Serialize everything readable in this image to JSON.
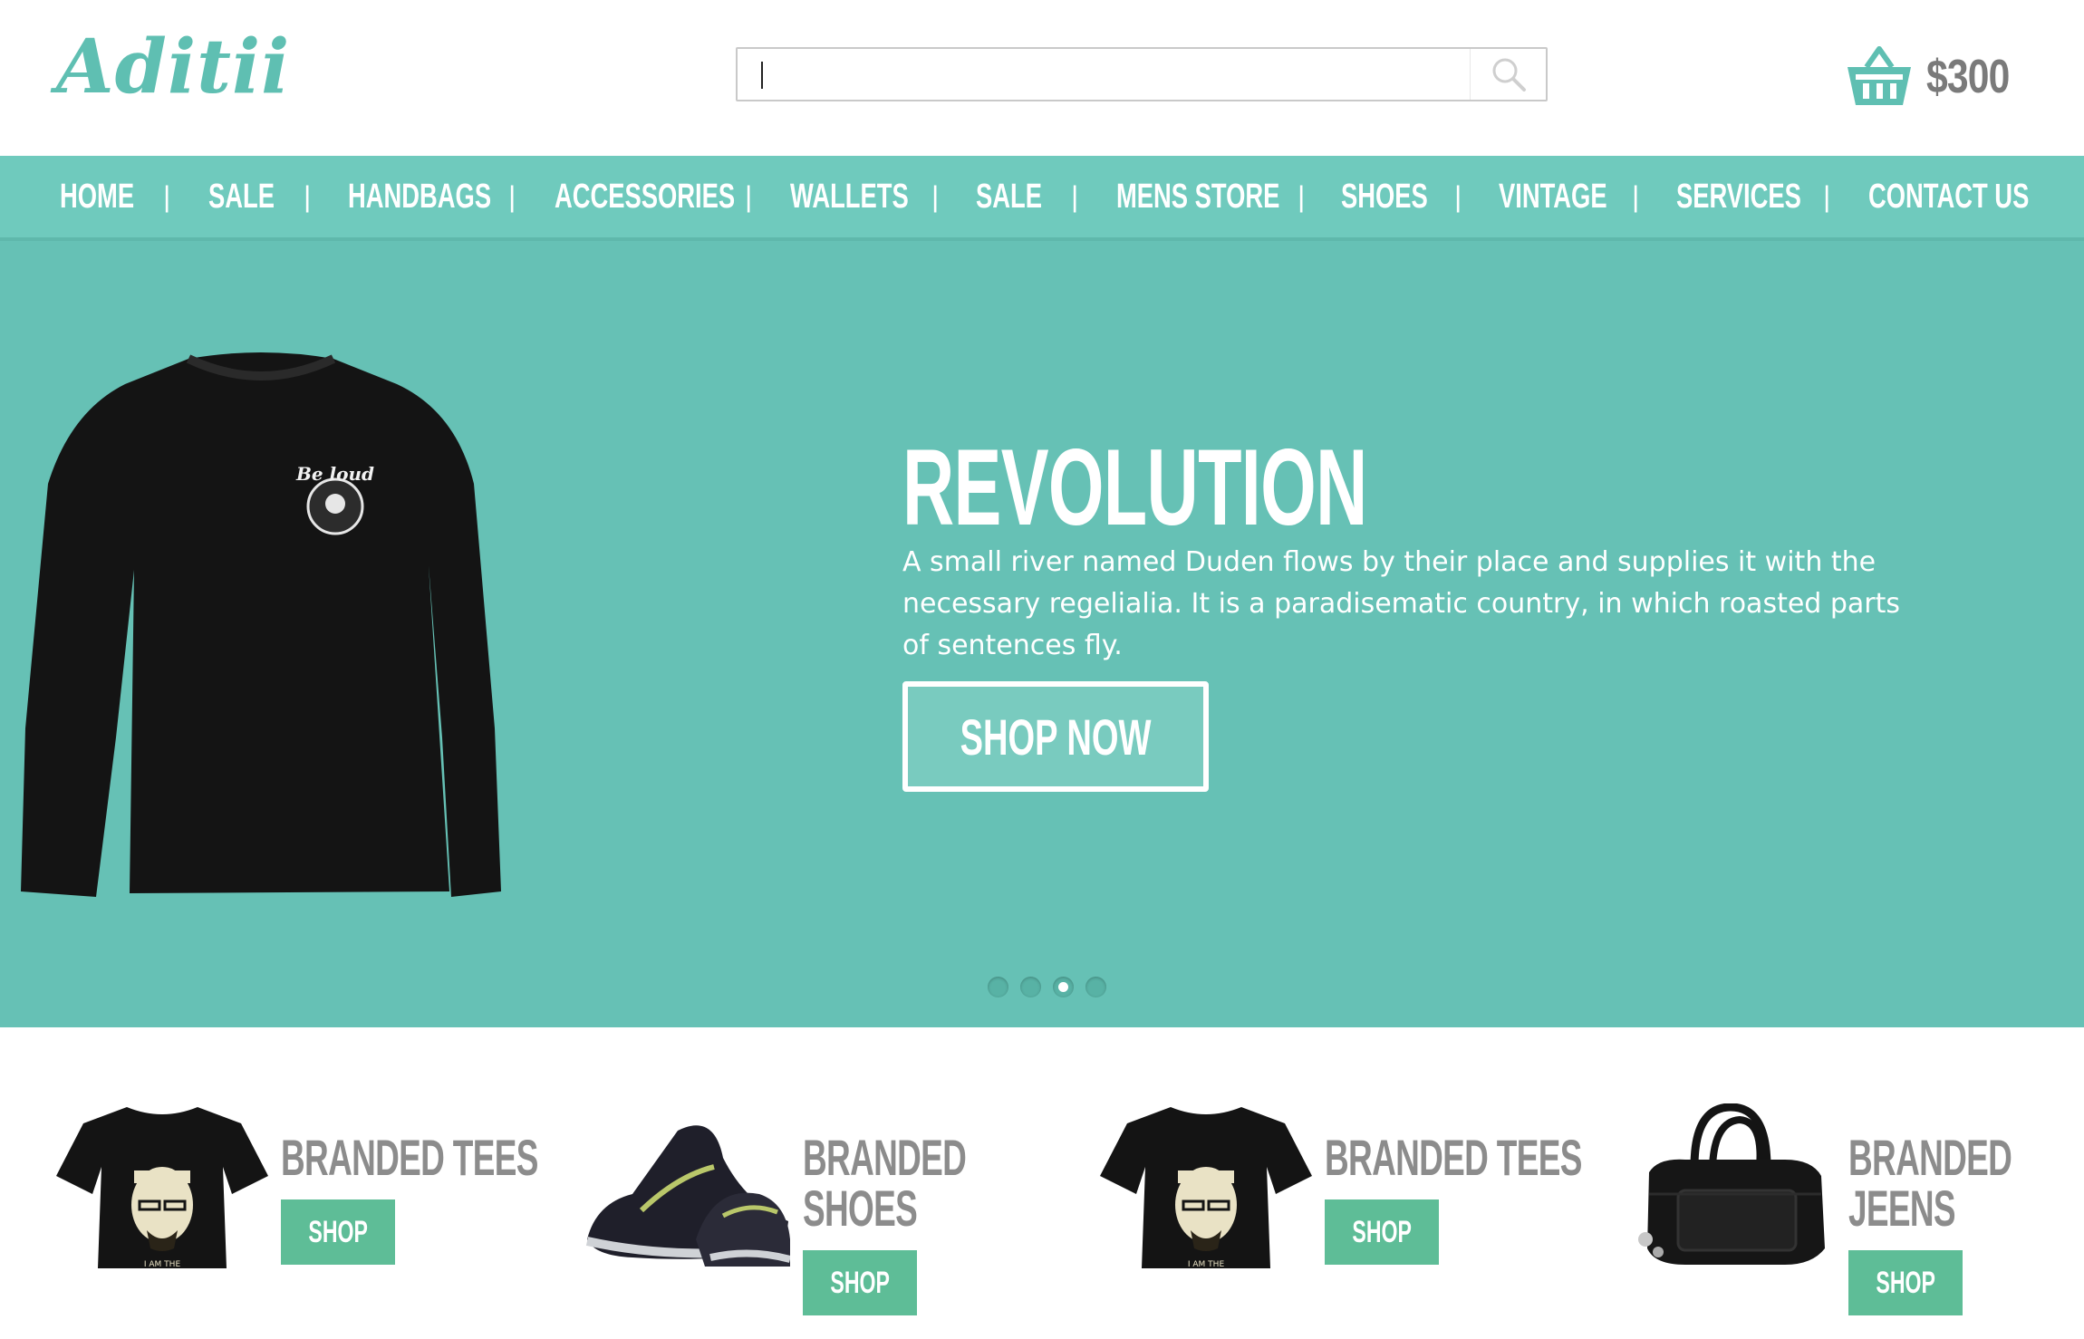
{
  "brand": {
    "logo_text": "Aditii"
  },
  "search": {
    "value": "",
    "placeholder": ""
  },
  "cart": {
    "total": "$300"
  },
  "nav": {
    "items": [
      "HOME",
      "SALE",
      "HANDBAGS",
      "ACCESSORIES",
      "WALLETS",
      "SALE",
      "MENS STORE",
      "SHOES",
      "VINTAGE",
      "SERVICES",
      "CONTACT US"
    ],
    "separator": "|"
  },
  "hero": {
    "title": "REVOLUTION",
    "text": "A small river named Duden flows by their place and supplies it with the necessary regelialia. It is a paradisematic country, in which roasted parts of sentences fly.",
    "button_label": "SHOP NOW",
    "shirt_print": "Be loud",
    "slides": 4,
    "active_slide": 3
  },
  "products": [
    {
      "title_lines": [
        "BRANDED TEES"
      ],
      "button_label": "SHOP",
      "shirt_print": "I AM THE"
    },
    {
      "title_lines": [
        "BRANDED",
        "SHOES"
      ],
      "button_label": "SHOP"
    },
    {
      "title_lines": [
        "BRANDED TEES"
      ],
      "button_label": "SHOP",
      "shirt_print": "I AM THE"
    },
    {
      "title_lines": [
        "BRANDED",
        "JEENS"
      ],
      "button_label": "SHOP"
    }
  ],
  "colors": {
    "accent": "#6fcabd",
    "hero_bg": "#66c1b5",
    "shop_button": "#5ebd97",
    "heading_gray": "#8c8c8c"
  }
}
